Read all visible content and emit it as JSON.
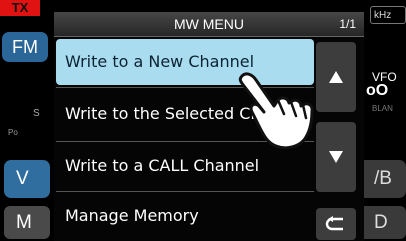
{
  "background": {
    "tx": "TX",
    "mode": "FM",
    "s_label": "S",
    "po_label": "Po",
    "left_btn_1": "V",
    "left_btn_2": "M",
    "khz": "kHz",
    "vfo": "VFO",
    "freq_partial": "oO",
    "blank_label": "BLAN",
    "right_btn_1": "/B",
    "right_btn_2": "D"
  },
  "menu": {
    "title": "MW MENU",
    "page": "1/1",
    "items": [
      {
        "label": "Write to a New Channel",
        "selected": true
      },
      {
        "label": "Write to the Selected Channel",
        "selected": false
      },
      {
        "label": "Write to a CALL Channel",
        "selected": false
      },
      {
        "label": "Manage Memory",
        "selected": false
      }
    ],
    "scroll_up_icon": "triangle-up-icon",
    "scroll_down_icon": "triangle-down-icon",
    "back_icon": "return-arrow-icon"
  },
  "colors": {
    "selected_bg": "#a9dcef",
    "tx_red": "#e01212",
    "blue_btn": "#2f6e9e"
  },
  "overlay": {
    "pointer_icon": "pointing-hand-icon"
  }
}
